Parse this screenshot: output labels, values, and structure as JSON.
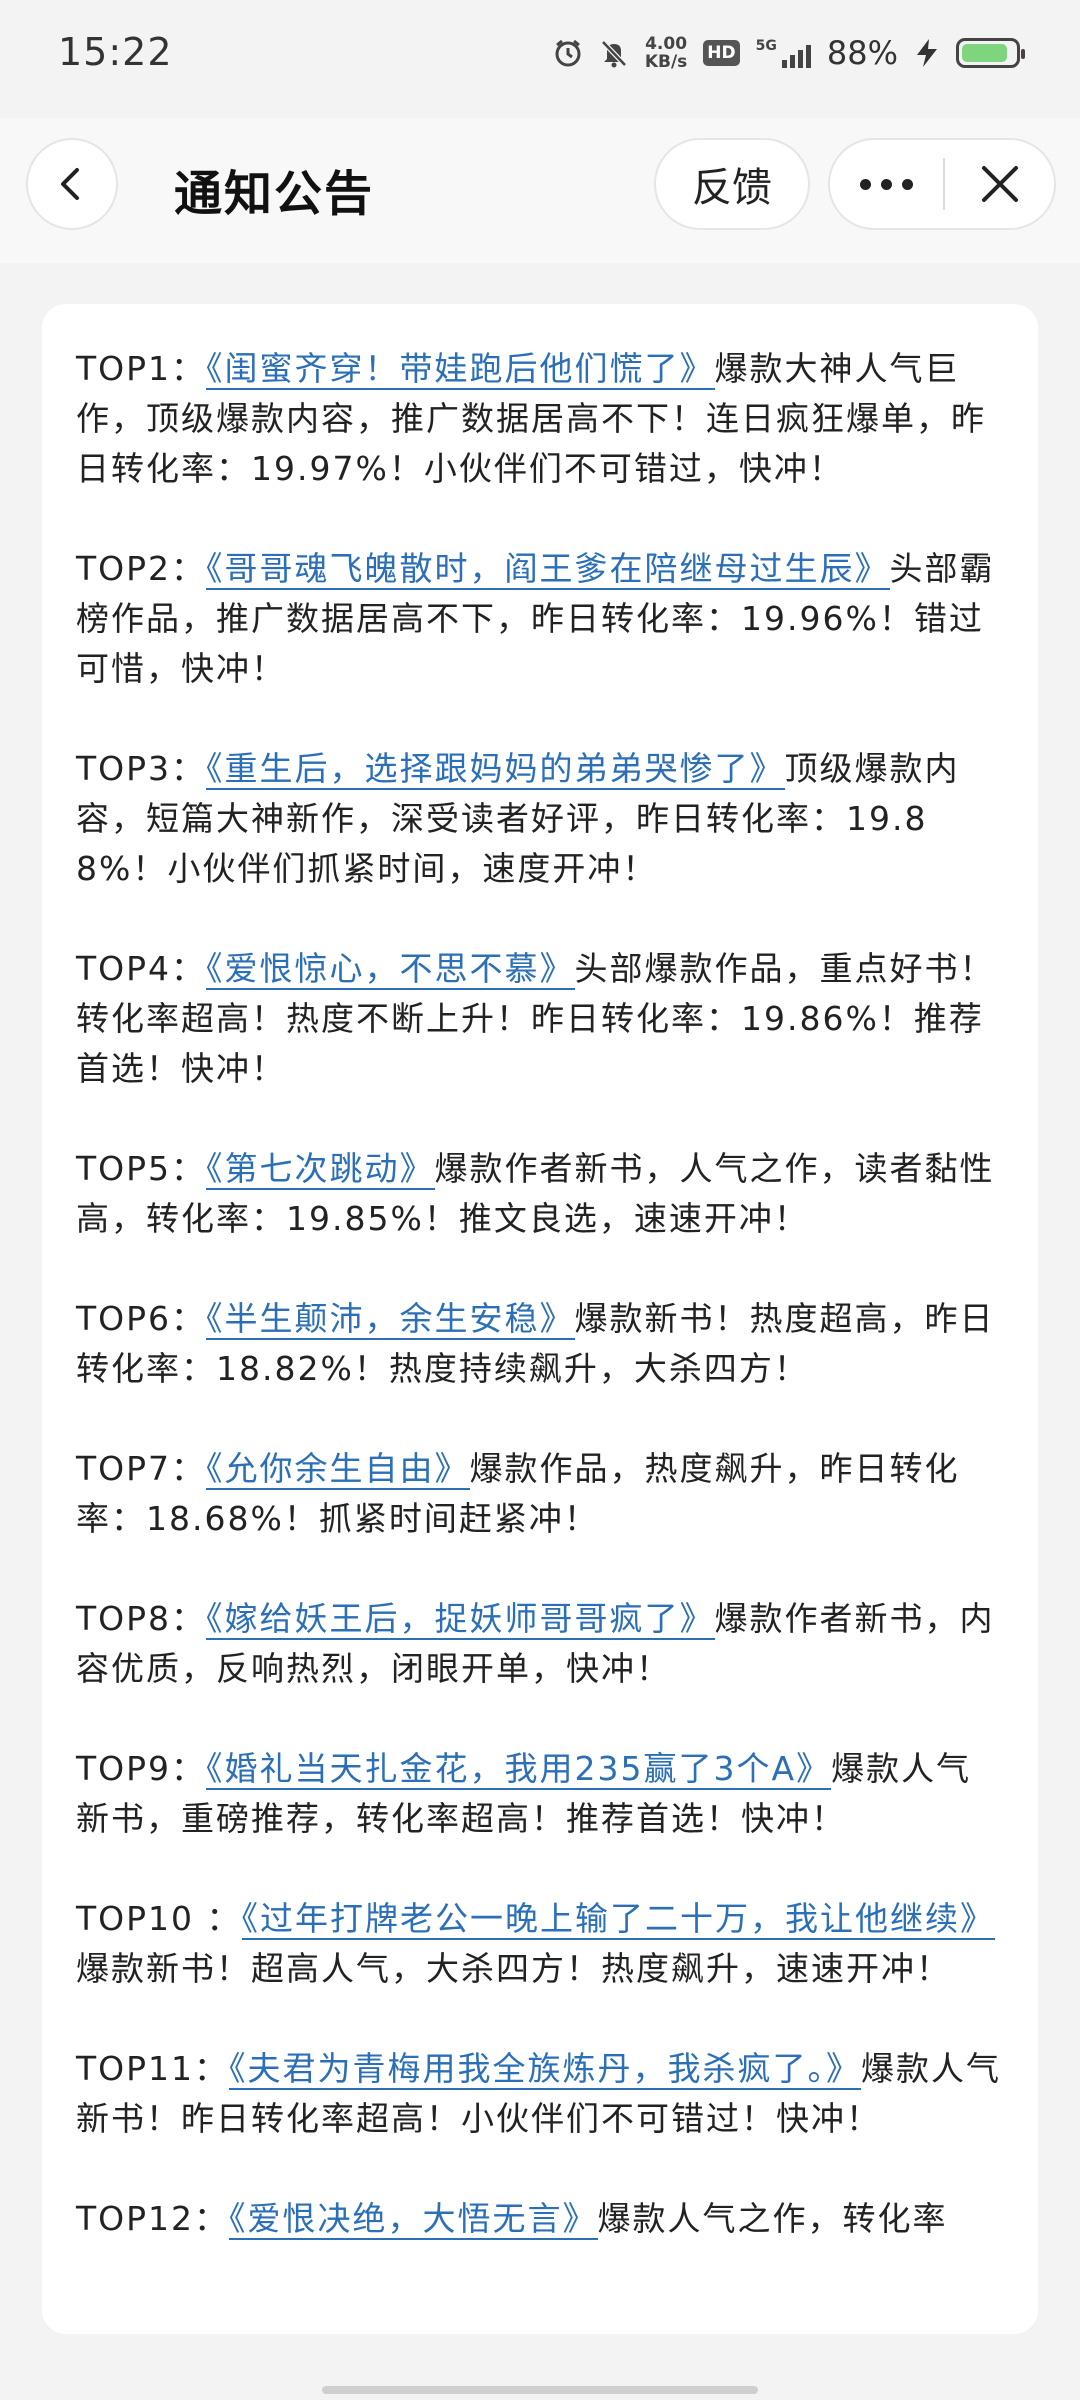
{
  "status_bar": {
    "time": "15:22",
    "net_speed_value": "4.00",
    "net_speed_unit": "KB/s",
    "hd_label": "HD",
    "network_label": "5G",
    "battery_percent": "88%",
    "battery_level": 0.88,
    "icons": [
      "alarm-icon",
      "mute-bell-icon",
      "signal-icon",
      "charging-icon",
      "battery-icon"
    ]
  },
  "header": {
    "title": "通知公告",
    "feedback_label": "反馈"
  },
  "items": [
    {
      "rank": "TOP1：",
      "book": "《闺蜜齐穿！带娃跑后他们慌了》",
      "desc": "爆款大神人气巨作，顶级爆款内容，推广数据居高不下！连日疯狂爆单，昨日转化率：19.97%！小伙伴们不可错过，快冲！"
    },
    {
      "rank": "TOP2：",
      "book": "《哥哥魂飞魄散时，阎王爹在陪继母过生辰》",
      "desc": "头部霸榜作品，推广数据居高不下，昨日转化率：19.96%！错过可惜，快冲！"
    },
    {
      "rank": "TOP3：",
      "book": "《重生后，选择跟妈妈的弟弟哭惨了》",
      "desc": "顶级爆款内容，短篇大神新作，深受读者好评，昨日转化率：19.88%！小伙伴们抓紧时间，速度开冲！"
    },
    {
      "rank": "TOP4：",
      "book": "《爱恨惊心，不思不慕》",
      "desc": "头部爆款作品，重点好书！转化率超高！热度不断上升！昨日转化率：19.86%！推荐首选！快冲！"
    },
    {
      "rank": "TOP5：",
      "book": "《第七次跳动》",
      "desc": "爆款作者新书，人气之作，读者黏性高，转化率：19.85%！推文良选，速速开冲！"
    },
    {
      "rank": "TOP6：",
      "book": "《半生颠沛，余生安稳》",
      "desc": "爆款新书！热度超高，昨日转化率：18.82%！热度持续飙升，大杀四方！"
    },
    {
      "rank": "TOP7：",
      "book": "《允你余生自由》",
      "desc": "爆款作品，热度飙升，昨日转化率：18.68%！抓紧时间赶紧冲！"
    },
    {
      "rank": "TOP8：",
      "book": "《嫁给妖王后，捉妖师哥哥疯了》",
      "desc": "爆款作者新书，内容优质，反响热烈，闭眼开单，快冲！"
    },
    {
      "rank": "TOP9：",
      "book": "《婚礼当天扎金花，我用235赢了3个A》",
      "desc": "爆款人气新书，重磅推荐，转化率超高！推荐首选！快冲！"
    },
    {
      "rank": "TOP10 ：",
      "book": "《过年打牌老公一晚上输了二十万，我让他继续》",
      "desc": "爆款新书！超高人气，大杀四方！热度飙升，速速开冲！"
    },
    {
      "rank": "TOP11：",
      "book": "《夫君为青梅用我全族炼丹，我杀疯了。》",
      "desc": "爆款人气新书！昨日转化率超高！小伙伴们不可错过！快冲！"
    },
    {
      "rank": "TOP12：",
      "book": "《爱恨决绝，大悟无言》",
      "desc": "爆款人气之作，转化率"
    }
  ]
}
